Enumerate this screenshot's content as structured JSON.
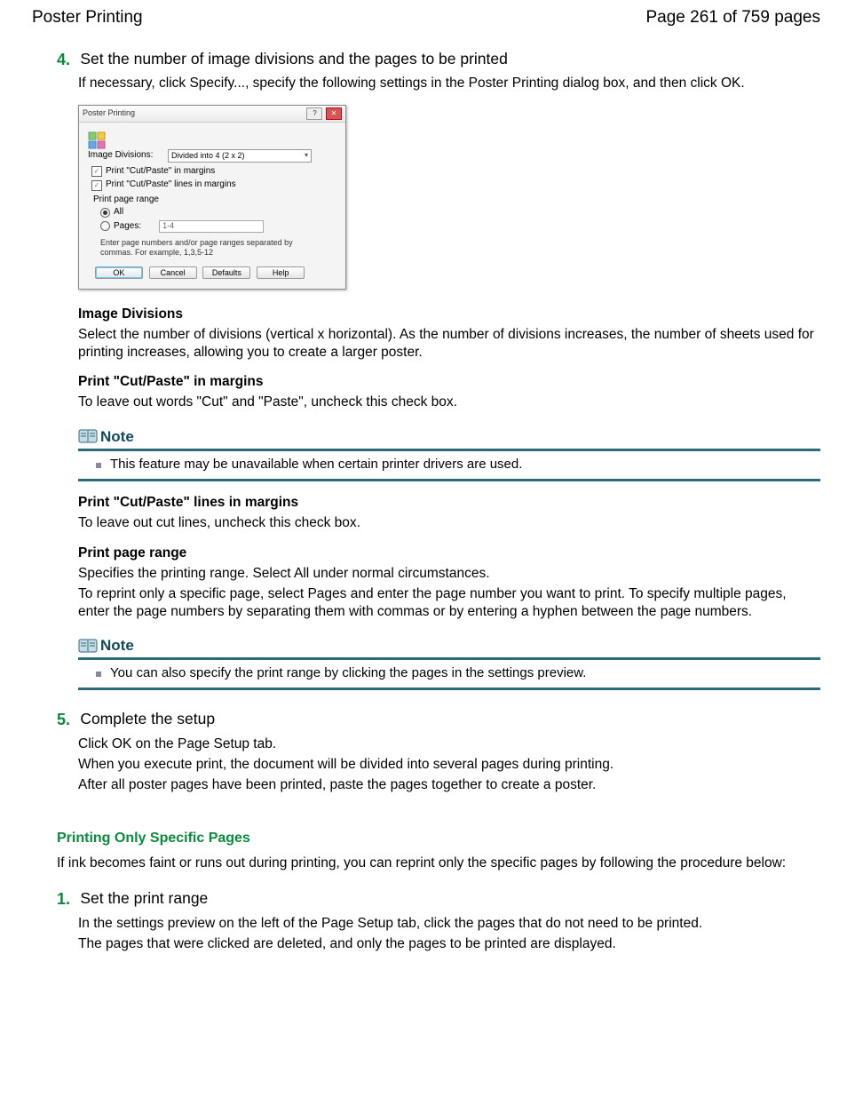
{
  "header": {
    "left": "Poster Printing",
    "right": "Page 261 of 759 pages"
  },
  "step4": {
    "num": "4.",
    "title": "Set the number of image divisions and the pages to be printed",
    "intro": "If necessary, click Specify..., specify the following settings in the Poster Printing dialog box, and then click OK."
  },
  "dialog": {
    "title": "Poster Printing",
    "image_div_label": "Image Divisions:",
    "image_div_value": "Divided into 4 (2 x 2)",
    "chk_cutpaste": "Print \"Cut/Paste\" in margins",
    "chk_lines": "Print \"Cut/Paste\" lines in margins",
    "range_label": "Print page range",
    "radio_all": "All",
    "radio_pages": "Pages:",
    "pages_value": "1-4",
    "hint": "Enter page numbers and/or page ranges separated by commas. For example, 1,3,5-12",
    "btn_ok": "OK",
    "btn_cancel": "Cancel",
    "btn_defaults": "Defaults",
    "btn_help": "Help"
  },
  "defs": {
    "img_div_h": "Image Divisions",
    "img_div_b": "Select the number of divisions (vertical x horizontal). As the number of divisions increases, the number of sheets used for printing increases, allowing you to create a larger poster.",
    "cutpaste_h": "Print \"Cut/Paste\" in margins",
    "cutpaste_b": "To leave out words \"Cut\" and \"Paste\", uncheck this check box.",
    "lines_h": "Print \"Cut/Paste\" lines in margins",
    "lines_b": "To leave out cut lines, uncheck this check box.",
    "range_h": "Print page range",
    "range_b1": "Specifies the printing range. Select All under normal circumstances.",
    "range_b2": "To reprint only a specific page, select Pages and enter the page number you want to print. To specify multiple pages, enter the page numbers by separating them with commas or by entering a hyphen between the page numbers."
  },
  "note1": {
    "head": "Note",
    "text": "This feature may be unavailable when certain printer drivers are used."
  },
  "note2": {
    "head": "Note",
    "text": "You can also specify the print range by clicking the pages in the settings preview."
  },
  "step5": {
    "num": "5.",
    "title": "Complete the setup",
    "b1": "Click OK on the Page Setup tab.",
    "b2": "When you execute print, the document will be divided into several pages during printing.",
    "b3": "After all poster pages have been printed, paste the pages together to create a poster."
  },
  "section2": {
    "head": "Printing Only Specific Pages",
    "intro": "If ink becomes faint or runs out during printing, you can reprint only the specific pages by following the procedure below:"
  },
  "s2step1": {
    "num": "1.",
    "title": "Set the print range",
    "b1": "In the settings preview on the left of the Page Setup tab, click the pages that do not need to be printed.",
    "b2": "The pages that were clicked are deleted, and only the pages to be printed are displayed."
  }
}
